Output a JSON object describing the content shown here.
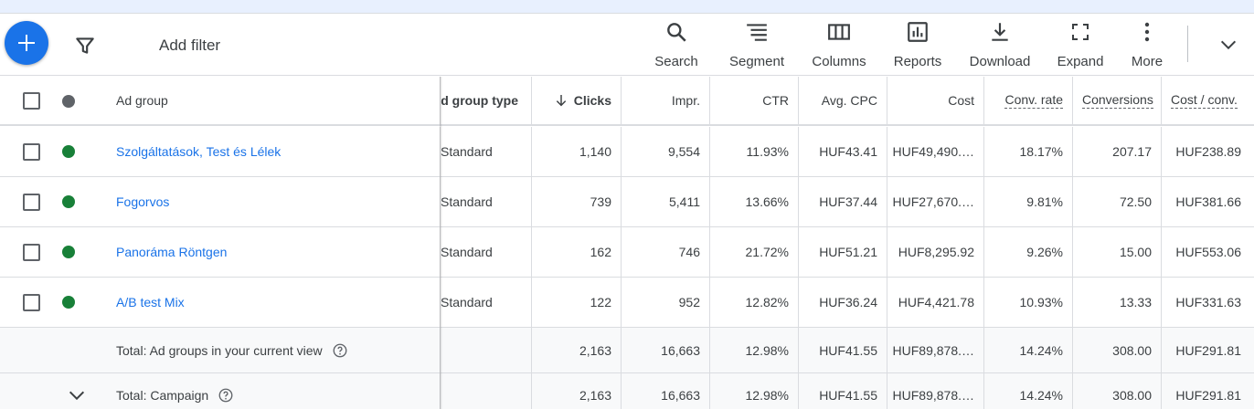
{
  "toolbar": {
    "add_filter": "Add filter",
    "tools": [
      {
        "label": "Search",
        "icon": "search-icon"
      },
      {
        "label": "Segment",
        "icon": "segment-icon"
      },
      {
        "label": "Columns",
        "icon": "columns-icon"
      },
      {
        "label": "Reports",
        "icon": "reports-icon"
      },
      {
        "label": "Download",
        "icon": "download-icon"
      },
      {
        "label": "Expand",
        "icon": "expand-icon"
      },
      {
        "label": "More",
        "icon": "more-vert-icon"
      }
    ]
  },
  "table": {
    "headers": {
      "ad_group": "Ad group",
      "ad_group_type": "Ad group type",
      "clicks": "Clicks",
      "impr": "Impr.",
      "ctr": "CTR",
      "avg_cpc": "Avg. CPC",
      "cost": "Cost",
      "conv_rate": "Conv. rate",
      "conversions": "Conversions",
      "cost_conv": "Cost / conv."
    },
    "rows": [
      {
        "name": "Szolgáltatások, Test és Lélek",
        "type": "Standard",
        "clicks": "1,140",
        "impr": "9,554",
        "ctr": "11.93%",
        "avg_cpc": "HUF43.41",
        "cost": "HUF49,490.…",
        "conv_rate": "18.17%",
        "conversions": "207.17",
        "cost_conv": "HUF238.89"
      },
      {
        "name": "Fogorvos",
        "type": "Standard",
        "clicks": "739",
        "impr": "5,411",
        "ctr": "13.66%",
        "avg_cpc": "HUF37.44",
        "cost": "HUF27,670.…",
        "conv_rate": "9.81%",
        "conversions": "72.50",
        "cost_conv": "HUF381.66"
      },
      {
        "name": "Panoráma Röntgen",
        "type": "Standard",
        "clicks": "162",
        "impr": "746",
        "ctr": "21.72%",
        "avg_cpc": "HUF51.21",
        "cost": "HUF8,295.92",
        "conv_rate": "9.26%",
        "conversions": "15.00",
        "cost_conv": "HUF553.06"
      },
      {
        "name": "A/B test Mix",
        "type": "Standard",
        "clicks": "122",
        "impr": "952",
        "ctr": "12.82%",
        "avg_cpc": "HUF36.24",
        "cost": "HUF4,421.78",
        "conv_rate": "10.93%",
        "conversions": "13.33",
        "cost_conv": "HUF331.63"
      }
    ],
    "totals": [
      {
        "label": "Total: Ad groups in your current view",
        "clicks": "2,163",
        "impr": "16,663",
        "ctr": "12.98%",
        "avg_cpc": "HUF41.55",
        "cost": "HUF89,878.…",
        "conv_rate": "14.24%",
        "conversions": "308.00",
        "cost_conv": "HUF291.81"
      },
      {
        "label": "Total: Campaign",
        "clicks": "2,163",
        "impr": "16,663",
        "ctr": "12.98%",
        "avg_cpc": "HUF41.55",
        "cost": "HUF89,878.…",
        "conv_rate": "14.24%",
        "conversions": "308.00",
        "cost_conv": "HUF291.81"
      }
    ]
  },
  "colors": {
    "primary": "#1a73e8",
    "status_enabled": "#188038",
    "status_header": "#5f6368"
  }
}
